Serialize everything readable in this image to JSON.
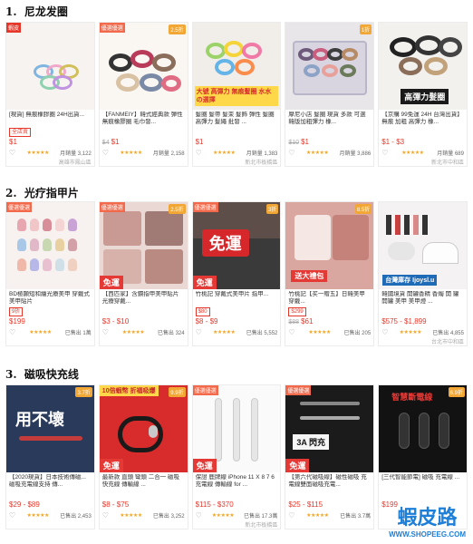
{
  "sections": [
    {
      "title": "1.  尼龙发圈",
      "products": [
        {
          "name": "[現貨] 無痕橡膠圈 24H出貨...",
          "ribbon": "蝦皮",
          "corner": "",
          "tag": "全店賣",
          "price": "$1",
          "orig_price": "",
          "sold": "月銷量 3,122",
          "location": "高雄市鳳山區",
          "free_ship": ""
        },
        {
          "name": "【FANMEIY】韓式經典款 彈性無痕橡膠圈 毛巾發...",
          "ribbon": "",
          "corner": "2.5折",
          "tag": "",
          "price": "$1",
          "orig_price": "$4",
          "sold": "月銷量 2,158",
          "location": "",
          "free_ship": ""
        },
        {
          "name": "髮圈 髮帶 髮束 髮飾 彈性 髮圈 高彈力 髮繩 批發 ...",
          "ribbon": "",
          "corner": "",
          "tag": "",
          "price": "$1",
          "orig_price": "",
          "sold": "月銷量 1,383",
          "location": "新北市板橋區",
          "free_ship": "",
          "banner": "大號 高彈力 無痕髮圈 水水の選擇"
        },
        {
          "name": "摩尼小店 髮圈 現貨 多款 可選 韓版加粗彈力 橡...",
          "ribbon": "",
          "corner": "1折",
          "tag": "",
          "price": "$1",
          "orig_price": "$10",
          "sold": "月銷量 3,886",
          "location": "",
          "free_ship": ""
        },
        {
          "name": "【京購 99免運 24H 台灣出貨】 無痕 加粗 高彈力 橡...",
          "ribbon": "",
          "corner": "",
          "tag": "",
          "price": "$1 - $3",
          "orig_price": "",
          "sold": "月銷量 689",
          "location": "新北市中和區",
          "free_ship": "",
          "banner": "高彈力髮圈"
        }
      ]
    },
    {
      "title": "2.  光疗指甲片",
      "products": [
        {
          "name": "BD極顯短和繪光療美甲 穿戴式美甲貼片",
          "ribbon": "",
          "corner": "",
          "tag": "9折",
          "price": "$199",
          "orig_price": "",
          "sold": "已售出 1萬",
          "location": "",
          "free_ship": ""
        },
        {
          "name": "【西匹家】含鑽指甲美甲貼片 光療穿戴...",
          "ribbon": "",
          "corner": "2.5折",
          "tag": "",
          "price": "$3 - $10",
          "orig_price": "",
          "sold": "已售出 324",
          "location": "",
          "free_ship": "免運"
        },
        {
          "name": "竹桃記 穿戴式美甲片 指甲...",
          "ribbon": "",
          "corner": "3折",
          "tag": "$80",
          "price": "$8 - $9",
          "orig_price": "",
          "sold": "已售出 5,552",
          "location": "",
          "free_ship": "免運"
        },
        {
          "name": "竹桃記【买一贈五】日韓美甲 穿戴...",
          "ribbon": "",
          "corner": "8.5折",
          "tag": "$299",
          "price": "$61",
          "orig_price": "$88",
          "sold": "已售出 205",
          "location": "",
          "free_ship": "",
          "banner": "送大禮包"
        },
        {
          "name": "韓國境貨 開罐香精 香燭 開 罐 開罐 美甲 美甲燈 ...",
          "ribbon": "",
          "corner": "",
          "tag": "",
          "price": "$575 - $1,899",
          "orig_price": "",
          "sold": "已售出 4,855",
          "location": "台北市中和區",
          "free_ship": "",
          "banner": "台灣庫存 Ijoysl.u"
        }
      ]
    },
    {
      "title": "3.  磁吸快充线",
      "products": [
        {
          "name": "【2020現貨】日本技術傳磁... 磁吸充電線支持 傳...",
          "ribbon": "",
          "corner": "3.7折",
          "tag": "",
          "price": "$29 - $89",
          "orig_price": "",
          "sold": "已售出 2,453",
          "location": "",
          "free_ship": "",
          "banner": "用不壞"
        },
        {
          "name": "最新款 直頭 彎頭 二合一 磁吸快充線 傳輸線 ...",
          "ribbon": "",
          "corner": "9.9折",
          "tag": "",
          "price": "$8 - $75",
          "orig_price": "",
          "sold": "已售出 3,252",
          "location": "",
          "free_ship": "免運",
          "banner": "10倍蝦幣 折福吸爆"
        },
        {
          "name": "保證 鹿牌線 iPhone 11 X 8 7 6 充電線 傳輸線 for ...",
          "ribbon": "",
          "corner": "",
          "tag": "",
          "price": "$115 - $370",
          "orig_price": "",
          "sold": "已售出 17.3萬",
          "location": "新北市板橋區",
          "free_ship": "免運"
        },
        {
          "name": "【第六代磁吸線】磁性磁吸 充電線雙面磁吸充電...",
          "ribbon": "",
          "corner": "",
          "tag": "",
          "price": "$25 - $115",
          "orig_price": "",
          "sold": "已售出 3.7萬",
          "location": "",
          "free_ship": "免運",
          "banner": "3A 閃充"
        },
        {
          "name": "[三代智能節電] 磁吸 充電線 ...",
          "ribbon": "",
          "corner": "6.9折",
          "tag": "",
          "price": "$199",
          "orig_price": "",
          "sold": "",
          "location": "",
          "free_ship": "",
          "banner": "智慧斷電線"
        }
      ]
    }
  ],
  "watermark": {
    "logo": "蝦皮路",
    "url": "WWW.SHOPEEG.COM"
  },
  "ui": {
    "heart": "♡",
    "stars": "★★★★★",
    "ad": "廣告",
    "free_ship_badge": "免運"
  }
}
